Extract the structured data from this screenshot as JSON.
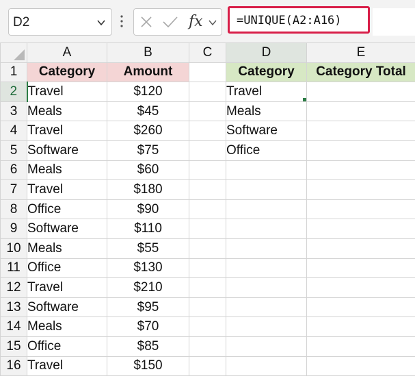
{
  "formula_bar": {
    "name_box": "D2",
    "name_box_icon": "chevron-down-icon",
    "cancel_icon": "cancel-x-icon",
    "enter_icon": "checkmark-icon",
    "function_label": "fx",
    "formula": "=UNIQUE(A2:A16)",
    "highlight_color": "#d81e48"
  },
  "columns": [
    "A",
    "B",
    "C",
    "D",
    "E"
  ],
  "selected": {
    "cell": "D2",
    "column": "D",
    "row": "2"
  },
  "row_numbers": [
    "1",
    "2",
    "3",
    "4",
    "5",
    "6",
    "7",
    "8",
    "9",
    "10",
    "11",
    "12",
    "13",
    "14",
    "15",
    "16"
  ],
  "headers": {
    "a": "Category",
    "b": "Amount",
    "d": "Category",
    "e": "Category Total"
  },
  "rows": [
    {
      "a": "Travel",
      "b": "$120",
      "d": "Travel"
    },
    {
      "a": "Meals",
      "b": "$45",
      "d": "Meals"
    },
    {
      "a": "Travel",
      "b": "$260",
      "d": "Software"
    },
    {
      "a": "Software",
      "b": "$75",
      "d": "Office"
    },
    {
      "a": "Meals",
      "b": "$60"
    },
    {
      "a": "Travel",
      "b": "$180"
    },
    {
      "a": "Office",
      "b": "$90"
    },
    {
      "a": "Software",
      "b": "$110"
    },
    {
      "a": "Meals",
      "b": "$55"
    },
    {
      "a": "Office",
      "b": "$130"
    },
    {
      "a": "Travel",
      "b": "$210"
    },
    {
      "a": "Software",
      "b": "$95"
    },
    {
      "a": "Meals",
      "b": "$70"
    },
    {
      "a": "Office",
      "b": "$85"
    },
    {
      "a": "Travel",
      "b": "$150"
    }
  ],
  "colors": {
    "header_pink": "#f4d5d5",
    "header_green": "#d7e8c4",
    "selection_green": "#2d7d46",
    "spill_blue": "#3a77d6"
  }
}
